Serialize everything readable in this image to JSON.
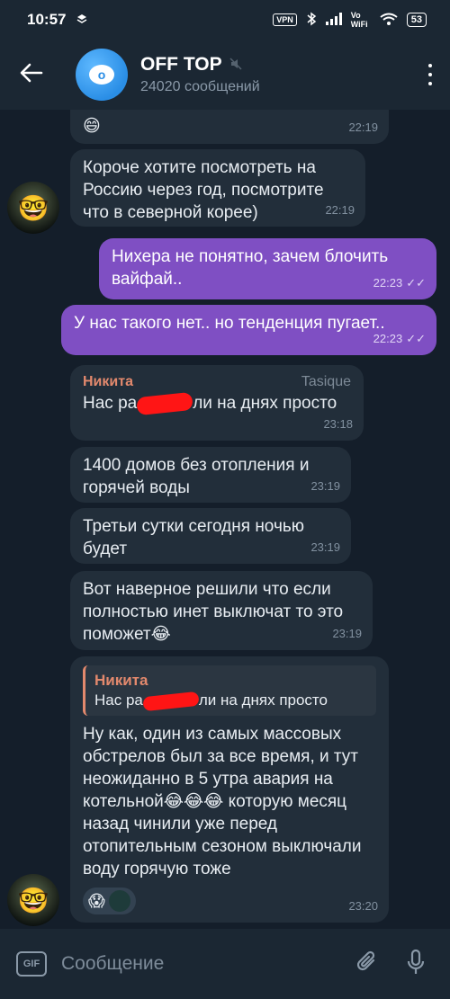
{
  "status": {
    "time": "10:57",
    "vpn": "VPN",
    "vowifi": "Vo WiFi",
    "battery": "53"
  },
  "header": {
    "channel_letter": "o",
    "title": "OFF TOP",
    "subtitle": "24020 сообщений"
  },
  "messages": [
    {
      "type": "in",
      "text": "😄",
      "time": "22:19"
    },
    {
      "type": "in",
      "text": "Короче хотите посмотреть на Россию через год, посмотрите что в северной корее)",
      "time": "22:19"
    },
    {
      "type": "out",
      "text": "Нихера не понятно, зачем блочить вайфай..",
      "time": "22:23"
    },
    {
      "type": "out",
      "text": "У нас такого нет.. но тенденция пугает..",
      "time": "22:23"
    },
    {
      "type": "in",
      "sender": "Никита",
      "sender_tag": "Tasique",
      "text_a": "Нас ра",
      "text_b": "ли на днях просто",
      "time": "23:18"
    },
    {
      "type": "in",
      "text": "1400 домов без отопления и горячей воды",
      "time": "23:19"
    },
    {
      "type": "in",
      "text": "Третьи сутки сегодня ночью будет",
      "time": "23:19"
    },
    {
      "type": "in",
      "text": "Вот наверное решили что если полностью инет выключат то это поможет😂",
      "time": "23:19"
    },
    {
      "type": "in",
      "reply_name": "Никита",
      "reply_a": "Нас ра",
      "reply_b": "ли на днях просто",
      "text": "Ну как, один из самых массовых обстрелов был за все время, и тут неожиданно в 5 утра авария на котельной😂😂😂 которую месяц назад чинили уже перед отопительным сезоном выключали воду горячую тоже",
      "reaction": "😱",
      "time": "23:20"
    }
  ],
  "input": {
    "placeholder": "Сообщение",
    "gif_label": "GIF"
  }
}
